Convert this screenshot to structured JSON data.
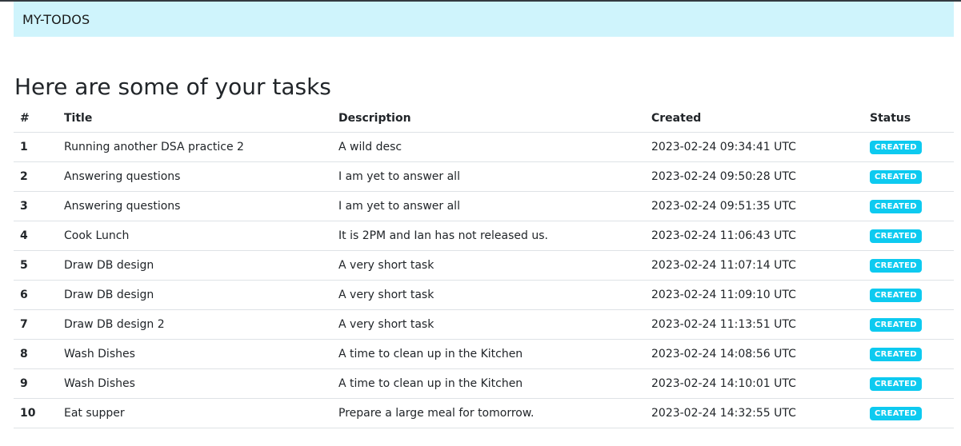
{
  "navbar": {
    "brand": "MY-TODOS"
  },
  "page": {
    "heading": "Here are some of your tasks"
  },
  "table": {
    "headers": {
      "num": "#",
      "title": "Title",
      "description": "Description",
      "created": "Created",
      "status": "Status"
    },
    "rows": [
      {
        "num": "1",
        "title": "Running another DSA practice 2",
        "description": "A wild desc",
        "created": "2023-02-24 09:34:41 UTC",
        "status": "CREATED"
      },
      {
        "num": "2",
        "title": "Answering questions",
        "description": "I am yet to answer all",
        "created": "2023-02-24 09:50:28 UTC",
        "status": "CREATED"
      },
      {
        "num": "3",
        "title": "Answering questions",
        "description": "I am yet to answer all",
        "created": "2023-02-24 09:51:35 UTC",
        "status": "CREATED"
      },
      {
        "num": "4",
        "title": "Cook Lunch",
        "description": "It is 2PM and Ian has not released us.",
        "created": "2023-02-24 11:06:43 UTC",
        "status": "CREATED"
      },
      {
        "num": "5",
        "title": "Draw DB design",
        "description": "A very short task",
        "created": "2023-02-24 11:07:14 UTC",
        "status": "CREATED"
      },
      {
        "num": "6",
        "title": "Draw DB design",
        "description": "A very short task",
        "created": "2023-02-24 11:09:10 UTC",
        "status": "CREATED"
      },
      {
        "num": "7",
        "title": "Draw DB design 2",
        "description": "A very short task",
        "created": "2023-02-24 11:13:51 UTC",
        "status": "CREATED"
      },
      {
        "num": "8",
        "title": "Wash Dishes",
        "description": "A time to clean up in the Kitchen",
        "created": "2023-02-24 14:08:56 UTC",
        "status": "CREATED"
      },
      {
        "num": "9",
        "title": "Wash Dishes",
        "description": "A time to clean up in the Kitchen",
        "created": "2023-02-24 14:10:01 UTC",
        "status": "CREATED"
      },
      {
        "num": "10",
        "title": "Eat supper",
        "description": "Prepare a large meal for tomorrow.",
        "created": "2023-02-24 14:32:55 UTC",
        "status": "CREATED"
      }
    ]
  },
  "colors": {
    "navbar_bg": "#cff4fc",
    "badge_bg": "#0dcaf0",
    "row_border": "#dee2e6"
  }
}
